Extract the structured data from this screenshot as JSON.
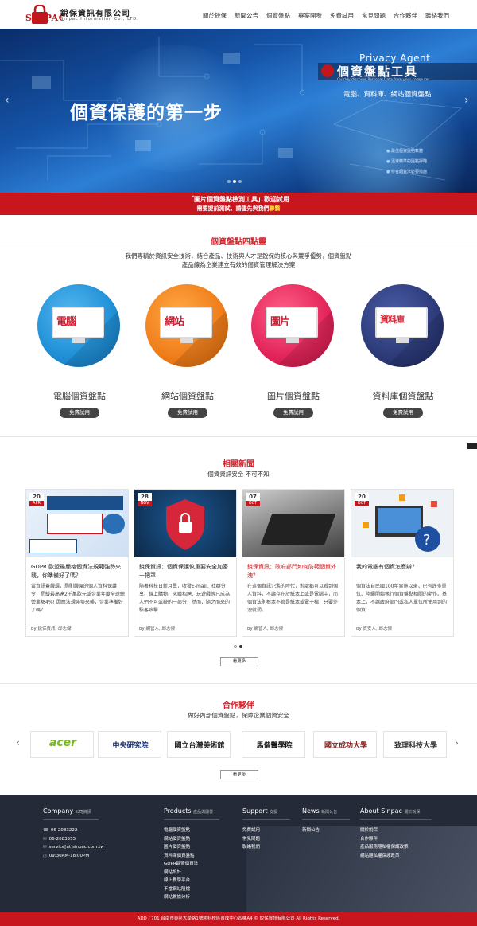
{
  "header": {
    "logo_word": "SINPAC",
    "logo_cn": "銳保資訊有限公司",
    "logo_en": "Sinpac Information Co., LTD.",
    "nav": [
      "關於銳保",
      "新聞公告",
      "個資盤點",
      "專案開發",
      "免費試用",
      "常見問題",
      "合作夥伴",
      "聯絡我們"
    ]
  },
  "hero": {
    "title": "個資保護的第一步",
    "en_title": "Privacy Agent",
    "cn_title": "個資盤點工具",
    "small_text": "Quickly discover Personal Data from your computer",
    "tags": "電腦、資料庫、網站個資盤點",
    "features": [
      "最佳個資盤點軟體",
      "迅速精準的盤點掃瞄",
      "符合個資法必要措施"
    ],
    "slides_total": 3,
    "slide_active": 2
  },
  "promo": {
    "line1": "「圖片個資盤點檢測工具」歡迎試用",
    "line2_prefix": "需要提前測試，請儘先與我們",
    "line2_link": "聯繫"
  },
  "features_section": {
    "title": "個資盤點四點靈",
    "desc_line1": "我們專精於資訊安全技術，結合產品、技術與人才是銳保的核心與競爭優勢，個資盤點",
    "desc_line2": "產品線為企業建立有效的個資管理解決方案",
    "products": [
      {
        "name": "電腦個資盤點",
        "screen_label": "電腦",
        "button": "免費試用",
        "color": "#1f8fd6"
      },
      {
        "name": "網站個資盤點",
        "screen_label": "網站",
        "button": "免費試用",
        "color": "#ef7d1a"
      },
      {
        "name": "圖片個資盤點",
        "screen_label": "圖片",
        "button": "免費試用",
        "color": "#e2245a"
      },
      {
        "name": "資料庫個資盤點",
        "screen_label": "資料庫",
        "button": "免費試用",
        "color": "#2c3a78"
      }
    ]
  },
  "news_section": {
    "title": "相關新聞",
    "subtitle": "個資資訊安全 不可不知",
    "items": [
      {
        "day": "20",
        "month": "APR",
        "title": "GDPR 歐盟最嚴格個資法規範強勢來襲，你準備好了嗎？",
        "title_red": false,
        "body": "當資訊蓋嚴環，罰則嚴厲的個人資料保護令，罰緩最高達2千萬歐元或企業年度全球總營業額4%! 因應法規強勢來襲，企業準備好了嗎？",
        "author": "by 銳保資訊, 邱志傑",
        "img": "#1a4f8c"
      },
      {
        "day": "28",
        "month": "NOV",
        "title": "銳保資訊：個資保護攸重要安全加密一把罩",
        "title_red": false,
        "body": "隨著科技日新月異，收發E-mail、社群分享、線上購物、求職招聘、玩遊戲等已成為人們不可或缺的一部分，然而，隨之而來的駭客攻擊",
        "author": "by 網管人, 邱志傑",
        "img": "#123a66"
      },
      {
        "day": "07",
        "month": "OCT",
        "title": "銳保資訊：政府部門如何防範個資外洩？",
        "title_red": true,
        "body": "在這個資訊氾濫的時代，對處都可以看到個人資料，不論存在於紙本上或是電腦中，而個資法則根本不管是紙本或電子檔，只要外洩就罰。",
        "author": "by 網管人, 邱志傑",
        "img": "#6a6a6a"
      },
      {
        "day": "20",
        "month": "OCT",
        "title": "我的電腦有個資怎麼辦？",
        "title_red": false,
        "body": "個資法自民國100年實施以來，已有許多單位、陸續開始執行個資盤點相關的動作。基本上，不論政府部門或私人單位所使用到的個資",
        "author": "by 資安人, 邱志傑",
        "img": "#e9eef4"
      }
    ],
    "more": "看更多"
  },
  "partners_section": {
    "title": "合作夥伴",
    "subtitle": "做好內部個資盤點，保障企業個資安全",
    "partners": [
      {
        "label": "acer",
        "color": "#7ab827"
      },
      {
        "label": "中央研究院",
        "color": "#1b2f6b"
      },
      {
        "label": "國立台灣美術館",
        "color": "#222222"
      },
      {
        "label": "馬偕醫學院",
        "color": "#111111"
      },
      {
        "label": "國立成功大學",
        "color": "#8c1d1d"
      },
      {
        "label": "致理科技大學",
        "color": "#333333"
      }
    ],
    "more": "看更多"
  },
  "footer": {
    "company": {
      "title": "Company",
      "sub": "公司資訊",
      "items": [
        {
          "icon": "☎",
          "text": "06-2083222"
        },
        {
          "icon": "✉",
          "text": "06-2083555"
        },
        {
          "icon": "✉",
          "text": "service[at]sinpac.com.tw"
        },
        {
          "icon": "◷",
          "text": "09:30AM-18:00PM"
        }
      ]
    },
    "products": {
      "title": "Products",
      "sub": "產品與開發",
      "items": [
        "電腦個資盤點",
        "網站個資盤點",
        "圖片個資盤點",
        "資料庫個資盤點",
        "GDPR歐盟個資法",
        "網站設計",
        "線上教學平台",
        "不當網站阻擋",
        "網站數據分析"
      ]
    },
    "support": {
      "title": "Support",
      "sub": "支援",
      "items": [
        "免費試用",
        "常見問題",
        "聯絡我們"
      ]
    },
    "news": {
      "title": "News",
      "sub": "新聞公告",
      "items": [
        "新聞公告"
      ]
    },
    "about": {
      "title": "About Sinpac",
      "sub": "關於銳保",
      "items": [
        "關於銳保",
        "合作夥伴",
        "產品服務隱私權保護政策",
        "網站隱私權保護政策"
      ]
    }
  },
  "copyright": "ADD / 701 台南市東區大學路1號國科校區育成中心四樓A4 © 銳保資訊有限公司 All Rights Reserved."
}
